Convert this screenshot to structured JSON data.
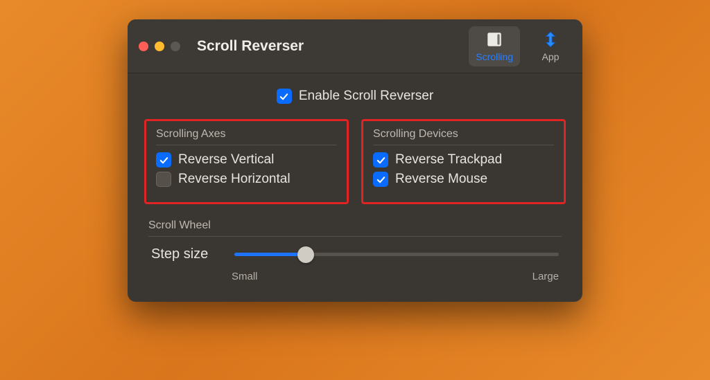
{
  "window": {
    "title": "Scroll Reverser"
  },
  "tabs": {
    "scrolling": "Scrolling",
    "app": "App"
  },
  "enable": {
    "label": "Enable Scroll Reverser",
    "checked": true
  },
  "groups": {
    "axes": {
      "title": "Scrolling Axes",
      "vertical": {
        "label": "Reverse Vertical",
        "checked": true
      },
      "horizontal": {
        "label": "Reverse Horizontal",
        "checked": false
      }
    },
    "devices": {
      "title": "Scrolling Devices",
      "trackpad": {
        "label": "Reverse Trackpad",
        "checked": true
      },
      "mouse": {
        "label": "Reverse Mouse",
        "checked": true
      }
    }
  },
  "wheel": {
    "title": "Scroll Wheel",
    "step_label": "Step size",
    "min_label": "Small",
    "max_label": "Large",
    "value_percent": 22
  }
}
